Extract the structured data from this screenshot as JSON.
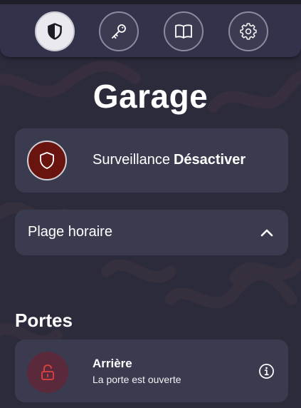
{
  "nav": {
    "items": [
      {
        "icon": "shield-icon",
        "active": true
      },
      {
        "icon": "key-icon",
        "active": false
      },
      {
        "icon": "book-icon",
        "active": false
      },
      {
        "icon": "gear-icon",
        "active": false
      }
    ]
  },
  "page": {
    "title": "Garage"
  },
  "surveillance": {
    "label": "Surveillance",
    "state": "Désactiver",
    "icon": "shield-icon",
    "color": "#6a1410"
  },
  "schedule": {
    "label": "Plage horaire",
    "icon": "chevron-up-icon"
  },
  "doors": {
    "section_title": "Portes",
    "items": [
      {
        "name": "Arrière",
        "status": "La porte est ouverte",
        "icon": "unlocked-padlock-icon",
        "info_icon": "info-icon",
        "status_color": "#e0433f"
      }
    ]
  },
  "colors": {
    "background": "#2b2b3c",
    "card": "#3b3b50",
    "alert": "#e0433f"
  }
}
